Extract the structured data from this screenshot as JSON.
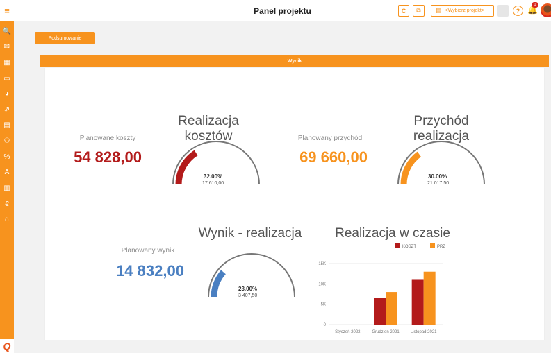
{
  "header": {
    "title": "Panel projektu",
    "project_select": "<Wybierz projekt>",
    "help_label": "?",
    "notification_count": "1"
  },
  "sidebar": {
    "items": [
      {
        "icon": "search-icon",
        "glyph": "🔍"
      },
      {
        "icon": "mail-icon",
        "glyph": "✉"
      },
      {
        "icon": "calendar-icon",
        "glyph": "▦"
      },
      {
        "icon": "inbox-icon",
        "glyph": "▭"
      },
      {
        "icon": "pie-chart-icon",
        "glyph": "◕"
      },
      {
        "icon": "export-icon",
        "glyph": "⇗"
      },
      {
        "icon": "map-icon",
        "glyph": "▤"
      },
      {
        "icon": "user-remove-icon",
        "glyph": "⚇"
      },
      {
        "icon": "percent-icon",
        "glyph": "%"
      },
      {
        "icon": "document-a-icon",
        "glyph": "A"
      },
      {
        "icon": "receipt-icon",
        "glyph": "▥"
      },
      {
        "icon": "euro-icon",
        "glyph": "€"
      },
      {
        "icon": "lock-icon",
        "glyph": "⌂"
      }
    ]
  },
  "main": {
    "summary_button": "Podsumowanie",
    "result_bar": "Wynik",
    "planned_costs_label": "Planowane koszty",
    "planned_costs_value": "54 828,00",
    "cost_realization_title": "Realizacja kosztów",
    "cost_gauge": {
      "percent_label": "32.00%",
      "value_label": "17 610,00",
      "fraction": 0.32
    },
    "planned_revenue_label": "Planowany przychód",
    "planned_revenue_value": "69 660,00",
    "revenue_realization_title": "Przychód realizacja",
    "revenue_gauge": {
      "percent_label": "30.00%",
      "value_label": "21 017,50",
      "fraction": 0.3
    },
    "planned_result_label": "Planowany wynik",
    "planned_result_value": "14 832,00",
    "result_realization_title": "Wynik - realizacja",
    "result_gauge": {
      "percent_label": "23.00%",
      "value_label": "3 407,50",
      "fraction": 0.23
    },
    "time_chart_title": "Realizacja w czasie"
  },
  "colors": {
    "accent": "#f7931e",
    "cost": "#b31b1b",
    "revenue": "#f7931e",
    "result": "#4a7fc1",
    "gauge_track": "#777777"
  },
  "chart_data": {
    "type": "bar",
    "title": "Realizacja w czasie",
    "categories": [
      "Styczeń 2022",
      "Grudzień 2021",
      "Listopad 2021"
    ],
    "series": [
      {
        "name": "KOSZT",
        "values": [
          0,
          6600,
          11000
        ],
        "color": "#b31b1b"
      },
      {
        "name": "PRZYCHÓD",
        "values": [
          0,
          8000,
          13000
        ],
        "color": "#f7931e"
      }
    ],
    "yticks": [
      "0",
      "5K",
      "10K",
      "15K"
    ],
    "ylim": [
      0,
      15000
    ],
    "legend": "top-right",
    "grid": true
  }
}
